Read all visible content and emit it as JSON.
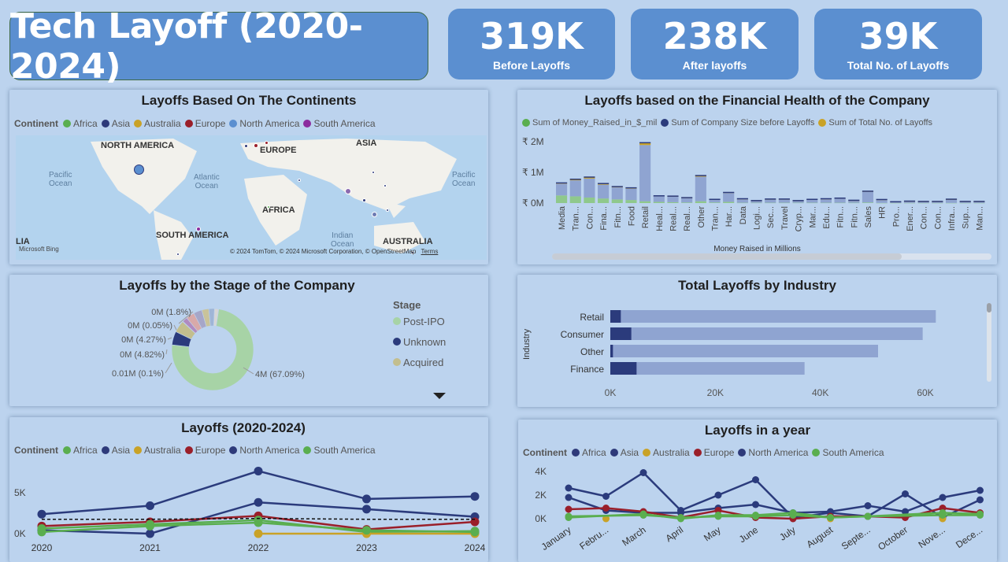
{
  "title": "Tech Layoff (2020-2024)",
  "kpis": [
    {
      "value": "319K",
      "label": "Before Layoffs"
    },
    {
      "value": "238K",
      "label": "After layoffs"
    },
    {
      "value": "39K",
      "label": "Total No. of Layoffs"
    }
  ],
  "colors": {
    "africa": "#5aae4f",
    "asia": "#2e3a7a",
    "australia": "#c9a227",
    "europe": "#9a1f2a",
    "north_america": "#5b8fd0",
    "south_america": "#8b2c9e",
    "navy": "#2b3b7c",
    "bar_light": "#8fa4d1"
  },
  "continents_map": {
    "title": "Layoffs Based On The Continents",
    "legend_title": "Continent",
    "legend": [
      "Africa",
      "Asia",
      "Australia",
      "Europe",
      "North America",
      "South America"
    ],
    "labels": {
      "na": "NORTH AMERICA",
      "eu": "EUROPE",
      "asia": "ASIA",
      "africa": "AFRICA",
      "sa": "SOUTH AMERICA",
      "au": "AUSTRALIA",
      "lia": "LIA"
    },
    "oceans": {
      "pacific": "Pacific\nOcean",
      "atlantic": "Atlantic\nOcean",
      "indian": "Indian\nOcean",
      "pacific2": "Pacific\nOcean"
    },
    "bing": "Microsoft Bing",
    "copyright": "© 2024 TomTom, © 2024 Microsoft Corporation, © OpenStreetMap",
    "terms": "Terms"
  },
  "financial": {
    "title": "Layoffs based on the Financial Health of the Company",
    "legend": [
      "Sum of Money_Raised_in_$_mil",
      "Sum of Company Size before Layoffs",
      "Sum of Total No. of Layoffs"
    ],
    "x_axis_title": "Money Raised in Millions"
  },
  "stage": {
    "title": "Layoffs by the Stage of the Company",
    "legend_title": "Stage",
    "legend": [
      "Post-IPO",
      "Unknown",
      "Acquired"
    ],
    "labels": [
      "0M (1.8%)",
      "0M (0.05%)",
      "0M (4.27%)",
      "0M (4.82%)",
      "0.01M (0.1%)",
      "4M (67.09%)"
    ]
  },
  "industry": {
    "title": "Total Layoffs by Industry",
    "y_axis_title": "Industry"
  },
  "trend": {
    "title": "Layoffs (2020-2024)",
    "legend_title": "Continent",
    "legend": [
      "Africa",
      "Asia",
      "Australia",
      "Europe",
      "North America",
      "South America"
    ]
  },
  "yearly": {
    "title": "Layoffs in a year",
    "legend_title": "Continent",
    "legend": [
      "Africa",
      "Asia",
      "Australia",
      "Europe",
      "North America",
      "South America"
    ]
  },
  "chart_data": [
    {
      "type": "bar",
      "title": "Layoffs based on the Financial Health of the Company",
      "xlabel": "Money Raised in Millions",
      "categories": [
        "Media",
        "Tran...",
        "Con...",
        "Fina...",
        "Fitn...",
        "Food",
        "Retail",
        "Heal...",
        "Real...",
        "Real...",
        "Other",
        "Tran...",
        "Har...",
        "Data",
        "Logi...",
        "Sec...",
        "Travel",
        "Cryp...",
        "Mar...",
        "Edu...",
        "Fitn...",
        "Fitn...",
        "Sales",
        "HR",
        "Pro...",
        "Ener...",
        "Con...",
        "Con...",
        "Infra...",
        "Sup...",
        "Man..."
      ],
      "yticks": [
        "₹ 0M",
        "₹ 1M",
        "₹ 2M"
      ],
      "ylim": [
        0,
        2000000
      ],
      "series": [
        {
          "name": "Sum of Money_Raised_in_$_mil",
          "values": [
            250000,
            220000,
            180000,
            150000,
            120000,
            100000,
            60000,
            40000,
            30000,
            20000,
            60000,
            20000,
            40000,
            10000,
            10000,
            10000,
            10000,
            10000,
            10000,
            10000,
            10000,
            10000,
            20000,
            5000,
            5000,
            5000,
            5000,
            5000,
            5000,
            5000,
            5000
          ]
        },
        {
          "name": "Sum of Company Size before Layoffs",
          "values": [
            380000,
            520000,
            620000,
            450000,
            390000,
            370000,
            1830000,
            180000,
            180000,
            140000,
            800000,
            90000,
            290000,
            120000,
            60000,
            110000,
            110000,
            60000,
            100000,
            120000,
            140000,
            70000,
            350000,
            100000,
            30000,
            50000,
            40000,
            40000,
            110000,
            40000,
            40000
          ]
        },
        {
          "name": "Sum of Total No. of Layoffs",
          "values": [
            20000,
            30000,
            40000,
            30000,
            20000,
            20000,
            70000,
            10000,
            10000,
            10000,
            30000,
            5000,
            10000,
            5000,
            5000,
            5000,
            5000,
            5000,
            5000,
            5000,
            5000,
            5000,
            10000,
            5000,
            2000,
            2000,
            2000,
            2000,
            5000,
            2000,
            2000
          ]
        }
      ]
    },
    {
      "type": "pie",
      "title": "Layoffs by the Stage of the Company",
      "slices": [
        {
          "label": "Post-IPO",
          "value": 67.09
        },
        {
          "label": "Unknown",
          "value": 4.82
        },
        {
          "label": "Acquired",
          "value": 4.27
        },
        {
          "label": "",
          "value": 0.1
        },
        {
          "label": "",
          "value": 0.05
        },
        {
          "label": "",
          "value": 1.8
        },
        {
          "label": "",
          "value": 3.0
        },
        {
          "label": "",
          "value": 3.0
        },
        {
          "label": "",
          "value": 2.5
        },
        {
          "label": "",
          "value": 2.0
        },
        {
          "label": "",
          "value": 1.5
        }
      ]
    },
    {
      "type": "bar",
      "title": "Total Layoffs by Industry",
      "ylabel": "Industry",
      "categories": [
        "Retail",
        "Consumer",
        "Other",
        "Finance"
      ],
      "xticks": [
        "0K",
        "20K",
        "40K",
        "60K"
      ],
      "xlim": [
        0,
        65000
      ],
      "series": [
        {
          "name": "dark",
          "values": [
            2000,
            4000,
            500,
            5000
          ]
        },
        {
          "name": "total",
          "values": [
            62000,
            59500,
            51000,
            37000
          ]
        }
      ]
    },
    {
      "type": "line",
      "title": "Layoffs (2020-2024)",
      "x": [
        "2020",
        "2021",
        "2022",
        "2023",
        "2024"
      ],
      "yticks": [
        "0K",
        "5K"
      ],
      "ylim": [
        0,
        8000
      ],
      "series": [
        {
          "name": "North America",
          "values": [
            2300,
            3300,
            7400,
            4100,
            4400
          ]
        },
        {
          "name": "Asia",
          "values": [
            400,
            0,
            3700,
            2900,
            2000
          ]
        },
        {
          "name": "Europe",
          "values": [
            900,
            1400,
            2100,
            500,
            1400
          ]
        },
        {
          "name": "Africa",
          "values": [
            600,
            1100,
            1600,
            200,
            300
          ]
        },
        {
          "name": "Australia",
          "values": [
            null,
            null,
            0,
            0,
            0
          ]
        },
        {
          "name": "South America",
          "values": [
            200,
            900,
            1300,
            400,
            200
          ]
        },
        {
          "name": "avg",
          "values": [
            1700,
            1700,
            1800,
            1700,
            1700
          ]
        }
      ]
    },
    {
      "type": "line",
      "title": "Layoffs in a year",
      "x": [
        "January",
        "Febru...",
        "March",
        "April",
        "May",
        "June",
        "July",
        "August",
        "Septe...",
        "October",
        "Nove...",
        "Dece..."
      ],
      "yticks": [
        "0K",
        "2K",
        "4K"
      ],
      "ylim": [
        0,
        4000
      ],
      "series": [
        {
          "name": "North America",
          "values": [
            2600,
            1900,
            3900,
            700,
            2000,
            3300,
            100,
            500,
            200,
            2100,
            100,
            1600
          ]
        },
        {
          "name": "Asia",
          "values": [
            1800,
            700,
            500,
            500,
            900,
            1200,
            500,
            600,
            1100,
            600,
            1800,
            2400
          ]
        },
        {
          "name": "Europe",
          "values": [
            800,
            900,
            600,
            100,
            700,
            100,
            0,
            200,
            200,
            100,
            900,
            500
          ]
        },
        {
          "name": "Australia",
          "values": [
            null,
            0,
            null,
            null,
            null,
            null,
            null,
            0,
            null,
            null,
            0,
            null
          ]
        },
        {
          "name": "South America",
          "values": [
            100,
            null,
            400,
            0,
            300,
            300,
            500,
            100,
            200,
            null,
            500,
            400
          ]
        },
        {
          "name": "Africa",
          "values": [
            200,
            null,
            300,
            100,
            200,
            200,
            300,
            100,
            200,
            null,
            300,
            300
          ]
        }
      ]
    }
  ]
}
